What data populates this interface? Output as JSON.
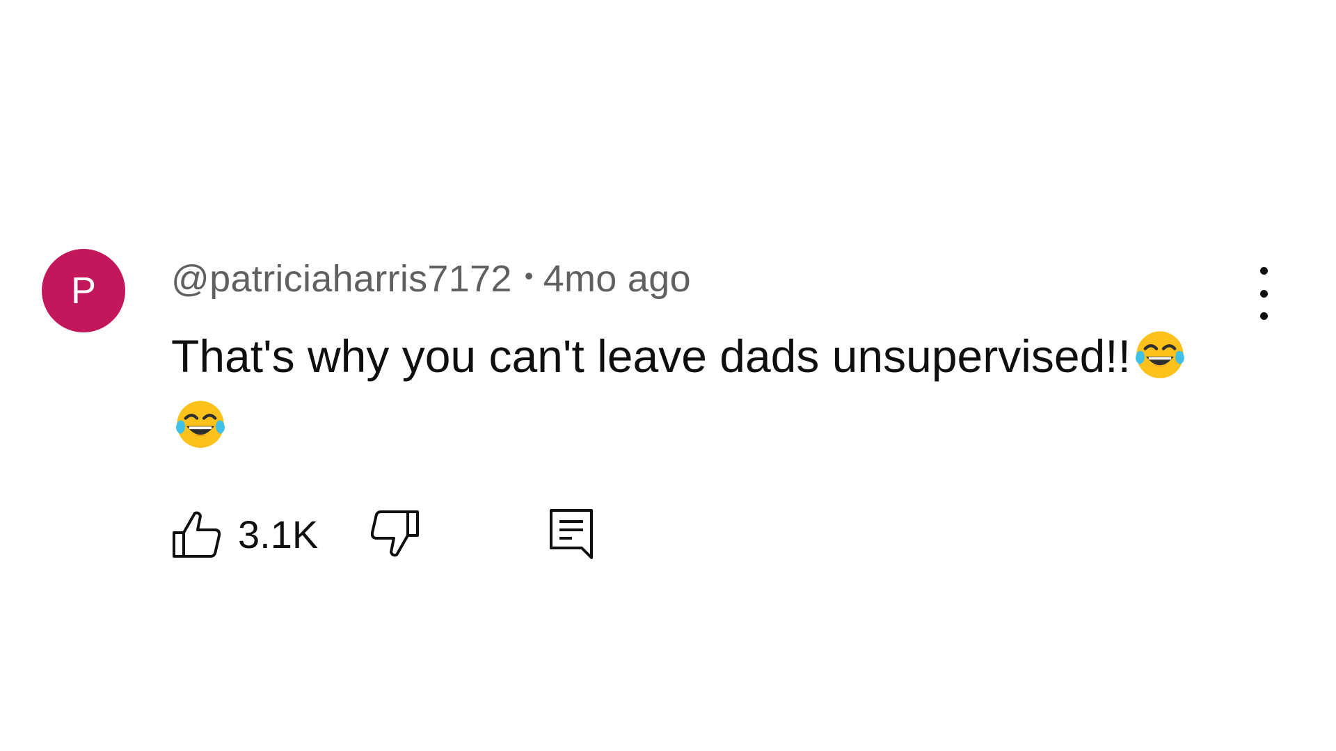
{
  "comment": {
    "avatar_letter": "P",
    "avatar_color": "#c2185b",
    "author": "@patriciaharris7172",
    "separator": "•",
    "time_ago": "4mo ago",
    "text": "That's why you can't leave dads unsupervised!!",
    "emojis": [
      "face-with-tears-of-joy-icon",
      "face-with-tears-of-joy-icon"
    ],
    "like_count": "3.1K"
  },
  "icons": {
    "like": "thumbs-up-icon",
    "dislike": "thumbs-down-icon",
    "reply": "reply-comment-icon",
    "more": "more-vertical-icon"
  }
}
